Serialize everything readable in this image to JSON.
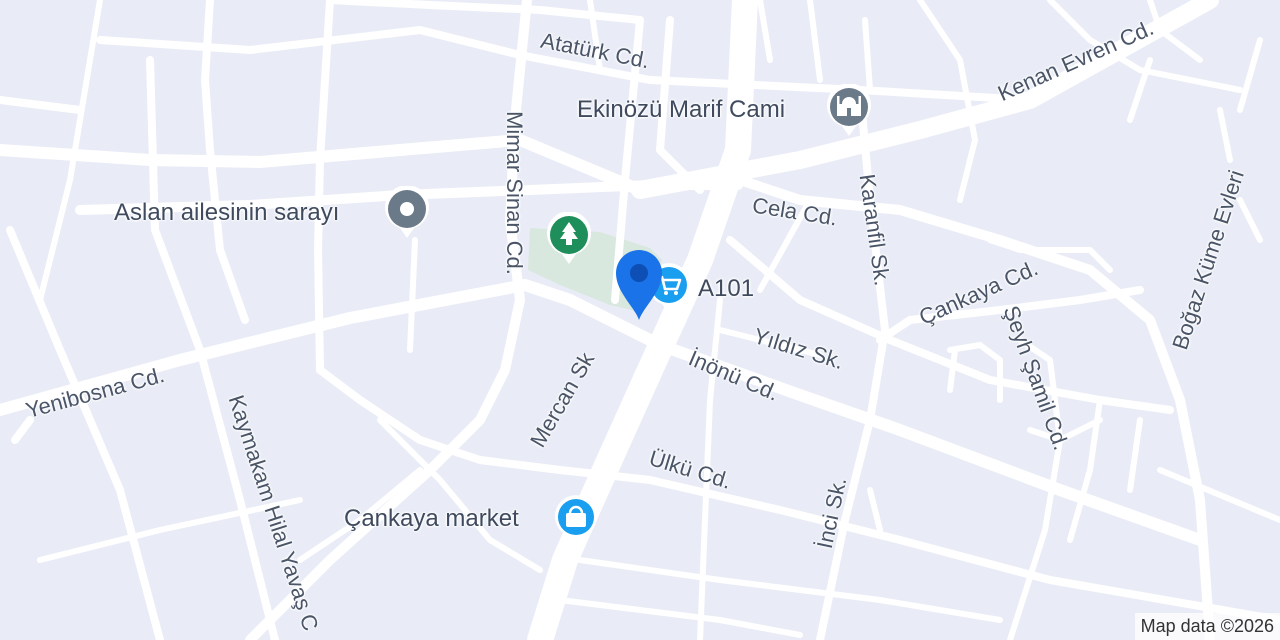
{
  "map": {
    "streets": {
      "ataturk": "Atatürk Cd.",
      "kenan_evren": "Kenan Evren Cd.",
      "mimar_sinan": "Mimar Sinan Cd.",
      "cela": "Cela Cd.",
      "karanfil": "Karanfil Sk.",
      "cankaya_cd": "Çankaya Cd.",
      "seyh_samil": "Şeyh Şamil Cd.",
      "bogaz_kume": "Boğaz Küme Evleri",
      "yildiz": "Yıldız Sk.",
      "inonu": "İnönü Cd.",
      "yenibosna": "Yenibosna Cd.",
      "mercan": "Mercan Sk",
      "ulku": "Ülkü Cd.",
      "inci": "İnci Sk.",
      "kaymakam": "Kaymakam Hilal Yavaş C"
    },
    "pois": {
      "mosque": "Ekinözü Marif Cami",
      "palace": "Aslan ailesinin sarayı",
      "grocery": "A101",
      "market": "Çankaya market"
    },
    "icons": {
      "mosque": "mosque-icon",
      "palace": "landmark-icon",
      "park": "tree-icon",
      "grocery": "shopping-cart-icon",
      "market": "shopping-bag-icon",
      "location": "location-pin-icon"
    },
    "colors": {
      "background": "#e9ecf6",
      "road": "#ffffff",
      "park": "#d9e8de",
      "park_icon": "#1e8e5a",
      "mosque_icon": "#6b7a89",
      "shop_icon": "#1a9ef0",
      "location_pin": "#1a73e8"
    },
    "attribution": "Map data ©2026"
  }
}
